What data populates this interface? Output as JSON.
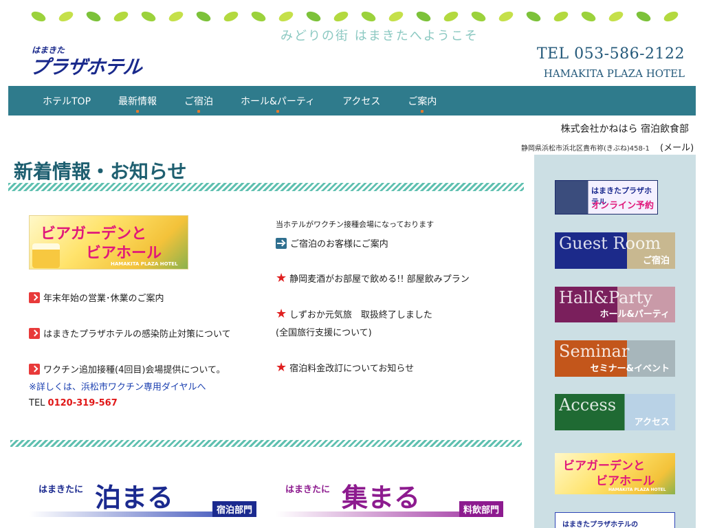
{
  "header": {
    "welcome": "みどりの街 はまきたへようこそ",
    "logo_small": "はまきた",
    "logo_big": "プラザホテル",
    "tel": "TEL 053-586-2122",
    "hotel_en": "HAMAKITA PLAZA HOTEL"
  },
  "nav": {
    "items": [
      {
        "label": "ホテルTOP"
      },
      {
        "label": "最新情報"
      },
      {
        "label": "ご宿泊"
      },
      {
        "label": "ホール&パーティ"
      },
      {
        "label": "アクセス"
      },
      {
        "label": "ご案内"
      }
    ]
  },
  "company": {
    "name": "株式会社かねはら  宿泊飲食部",
    "address": "静岡県浜松市浜北区貴布祢(きぶね)458-1",
    "mail": "(メール)"
  },
  "main": {
    "title": "新着情報・お知らせ",
    "beer_banner": {
      "line1": "ビアガーデンと",
      "line2": "ビアホール",
      "sub": "HAMAKITA PLAZA HOTEL"
    },
    "left_news": [
      "年末年始の営業･休業のご案内",
      "はまきたプラザホテルの感染防止対策について",
      "ワクチン追加接種(4回目)会場提供について。"
    ],
    "vaccine_note": "※詳しくは、浜松市ワクチン専用ダイヤルへ",
    "tel_label": "TEL ",
    "tel_number": "0120-319-567",
    "right_intro": "当ホテルがワクチン接種会場になっております",
    "right_news": [
      "ご宿泊のお客様にご案内",
      "静岡麦酒がお部屋で飲める!! 部屋飲みプラン",
      "しずおか元気旅　取扱終了しました",
      "(全国旅行支援について)",
      "宿泊料金改訂についてお知らせ"
    ],
    "stay_banner": {
      "pre": "はまきたに",
      "big": "泊まる",
      "tag": "宿泊部門"
    },
    "gather_banner": {
      "pre": "はまきたに",
      "big": "集まる",
      "tag": "料飲部門"
    }
  },
  "sidebar": {
    "online": {
      "line1": "はまきたプラザホテル",
      "line2": "オンライン予約"
    },
    "guest": {
      "en": "Guest Room",
      "jp": "ご宿泊"
    },
    "hall": {
      "en": "Hall&Party",
      "jp": "ホール&パーティ"
    },
    "seminar": {
      "en": "Seminar",
      "jp": "セミナー&イベント"
    },
    "access": {
      "en": "Access",
      "jp": "アクセス"
    },
    "beer": {
      "line1": "ビアガーデンと",
      "line2": "ビアホール",
      "sub": "HAMAKITA PLAZA HOTEL"
    },
    "infection": {
      "text": "はまきたプラザホテルの"
    }
  },
  "colors": {
    "nav_bg": "#2f7b8c",
    "title": "#1e5f70",
    "sidebar_bg": "#ccdfe4",
    "accent_red": "#e01818",
    "link_blue": "#1a3fb0"
  }
}
